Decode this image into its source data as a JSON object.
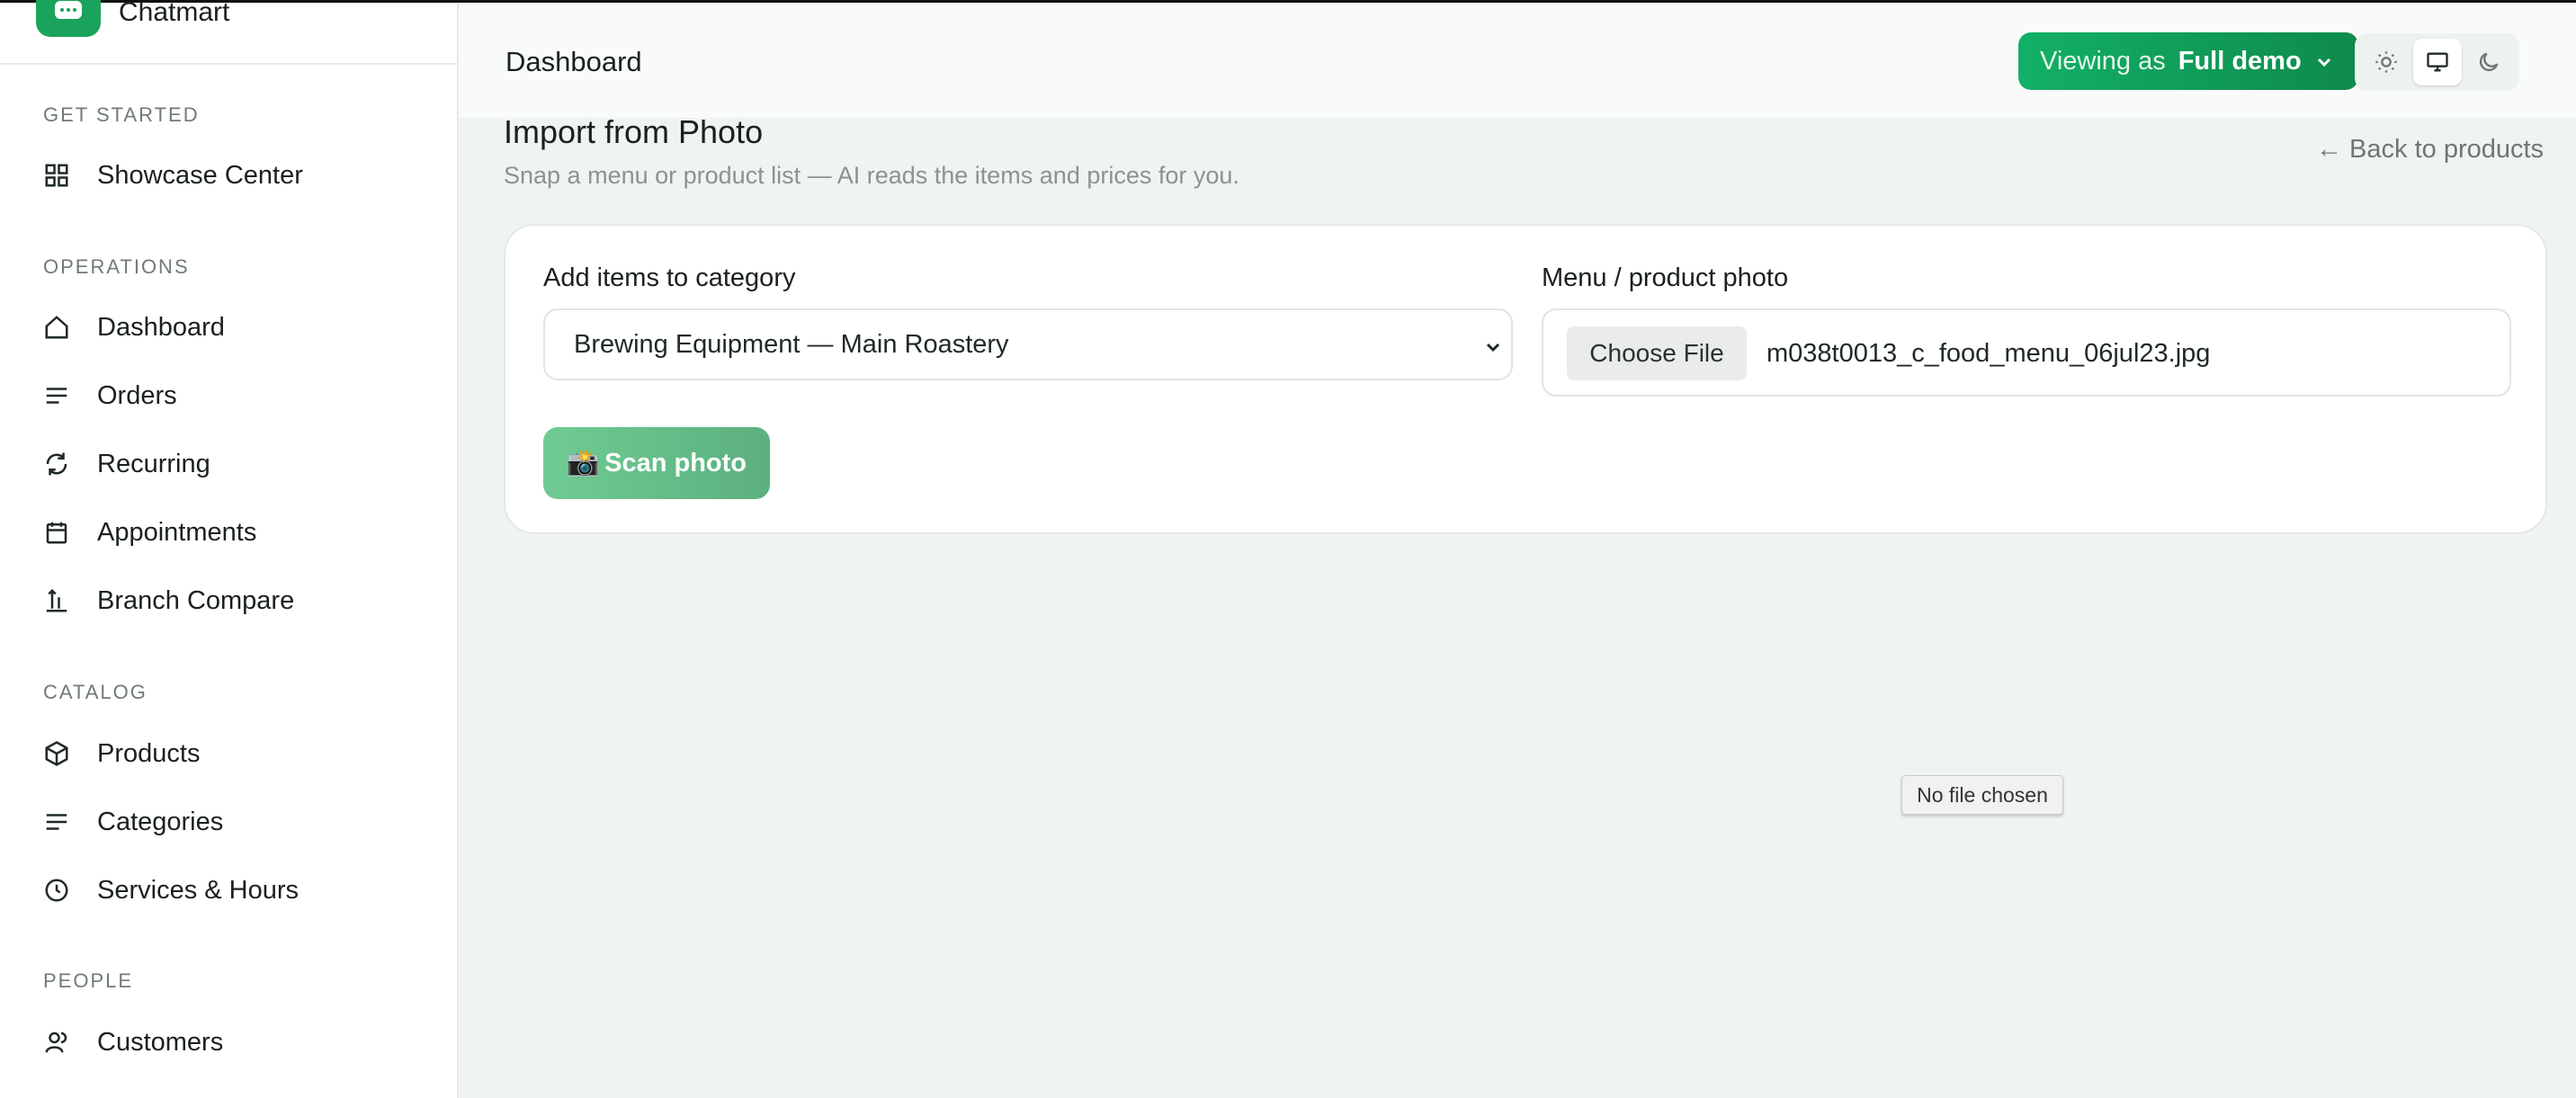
{
  "brand": {
    "name": "Chatmart"
  },
  "sidebar": {
    "sections": [
      {
        "title": "GET STARTED",
        "items": [
          {
            "label": "Showcase Center",
            "icon": "grid-icon"
          }
        ]
      },
      {
        "title": "OPERATIONS",
        "items": [
          {
            "label": "Dashboard",
            "icon": "home-icon"
          },
          {
            "label": "Orders",
            "icon": "lines-icon"
          },
          {
            "label": "Recurring",
            "icon": "refresh-icon"
          },
          {
            "label": "Appointments",
            "icon": "calendar-icon"
          },
          {
            "label": "Branch Compare",
            "icon": "sort-icon"
          }
        ]
      },
      {
        "title": "CATALOG",
        "items": [
          {
            "label": "Products",
            "icon": "box-icon"
          },
          {
            "label": "Categories",
            "icon": "lines-icon"
          },
          {
            "label": "Services & Hours",
            "icon": "clock-icon"
          }
        ]
      },
      {
        "title": "PEOPLE",
        "items": [
          {
            "label": "Customers",
            "icon": "users-icon"
          }
        ]
      }
    ]
  },
  "header": {
    "title": "Dashboard",
    "viewing_prefix": "Viewing as",
    "viewing_value": "Full demo",
    "theme_options": [
      "light",
      "system",
      "dark"
    ],
    "theme_selected": "system"
  },
  "main": {
    "title": "Import from Photo",
    "subtitle": "Snap a menu or product list — AI reads the items and prices for you.",
    "back_link": "← Back to products",
    "category_label": "Add items to category",
    "category_value": "Brewing Equipment — Main Roastery",
    "photo_label": "Menu / product photo",
    "choose_file_label": "Choose File",
    "file_name": "m038t0013_c_food_menu_06jul23.jpg",
    "scan_icon": "📸",
    "scan_label": "Scan photo",
    "tooltip": "No file chosen"
  },
  "colors": {
    "accent": "#12b066",
    "background": "#eff4f0"
  }
}
